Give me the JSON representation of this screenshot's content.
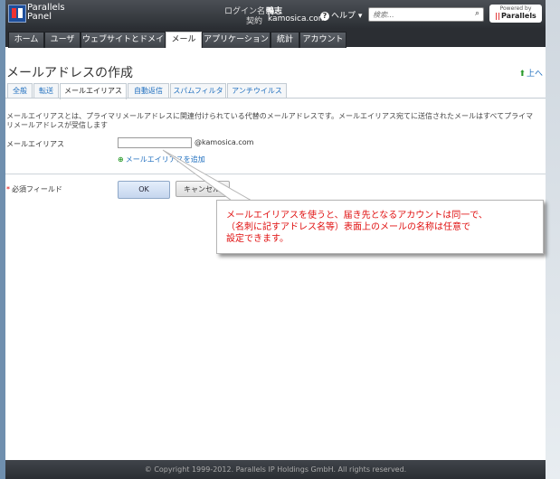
{
  "header": {
    "logo_line1": "Parallels",
    "logo_line2": "Panel",
    "login_label": "ログイン名:",
    "login_user": "鴨志",
    "contract_label": "契約",
    "contract_domain": "kamosica.com",
    "help_label": "ヘルプ",
    "search_placeholder": "検索...",
    "powered_by": "Powered by",
    "powered_brand": "Parallels"
  },
  "nav": {
    "tabs": [
      {
        "label": "ホーム"
      },
      {
        "label": "ユーザ"
      },
      {
        "label": "ウェブサイトとドメイン"
      },
      {
        "label": "メール"
      },
      {
        "label": "アプリケーション"
      },
      {
        "label": "統計"
      },
      {
        "label": "アカウント"
      }
    ],
    "active_tab": "メール"
  },
  "page": {
    "title": "メールアドレスの作成",
    "up_link": "上へ",
    "subtabs": [
      {
        "label": "全般"
      },
      {
        "label": "転送"
      },
      {
        "label": "メールエイリアス"
      },
      {
        "label": "自動返信"
      },
      {
        "label": "スパムフィルタ"
      },
      {
        "label": "アンチウイルス"
      }
    ],
    "active_subtab": "メールエイリアス",
    "description": "メールエイリアスとは、プライマリメールアドレスに関連付けられている代替のメールアドレスです。メールエイリアス宛てに送信されたメールはすべてプライマリメールアドレスが受信します",
    "alias_field_label": "メールエイリアス",
    "alias_value": "",
    "domain_suffix": "@kamosica.com",
    "add_alias_link": "メールエイリアスを追加",
    "required_label": "必須フィールド",
    "ok_label": "OK",
    "cancel_label": "キャンセル"
  },
  "callout": {
    "line1": "メールエイリアスを使うと、届き先となるアカウントは同一で、",
    "line2": "（名刺に記すアドレス名等）表面上のメールの名称は任意で",
    "line3": "設定できます。"
  },
  "footer": {
    "copyright": "© Copyright 1999-2012. Parallels IP Holdings GmbH. All rights reserved."
  },
  "colors": {
    "header_bg": "#2b2e33",
    "link": "#1f6fbf",
    "callout_text": "#e01010"
  }
}
